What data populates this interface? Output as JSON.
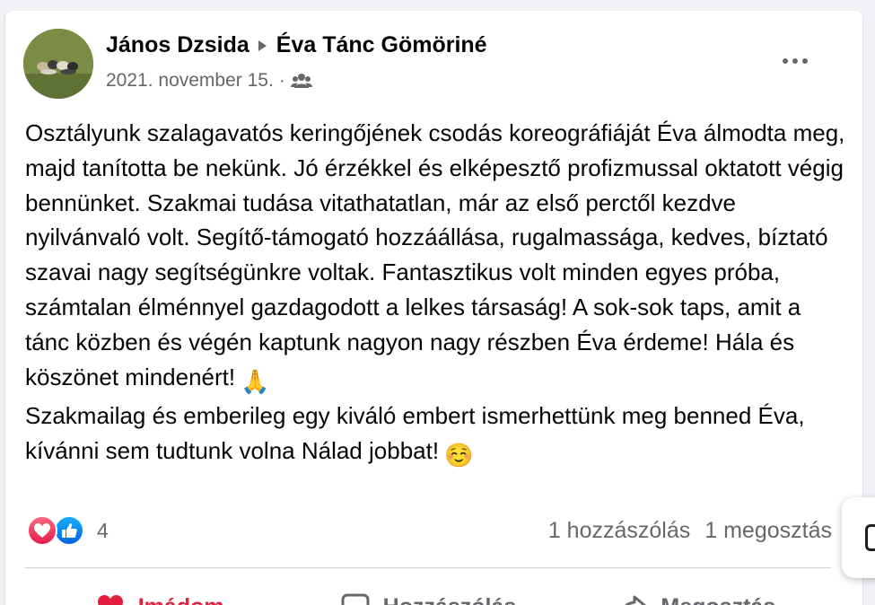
{
  "post": {
    "author": "János Dzsida",
    "target": "Éva Tánc Gömöriné",
    "date": "2021. november 15.",
    "separator": "·",
    "privacy_icon": "friends-icon",
    "paragraph1": "Osztályunk szalagavatós keringőjének csodás koreográfiáját Éva álmodta meg, majd tanította be nekünk. Jó érzékkel és elképesztő profizmussal oktatott végig bennünket. Szakmai tudása vitathatatlan, már az első perctől kezdve nyilvánvaló volt. Segítő-támogató hozzáállása, rugalmassága, kedves, bíztató szavai nagy segítségünkre voltak. Fantasztikus volt minden egyes próba, számtalan élménnyel gazdagodott a lelkes társaság! A sok-sok taps, amit a tánc közben és végén kaptunk nagyon nagy részben Éva érdeme! Hála és köszönet mindenért!",
    "paragraph1_emoji": "🙏",
    "paragraph2": "Szakmailag és emberileg egy kiváló embert ismerhettünk meg benned Éva, kívánni sem tudtunk volna Nálad jobbat!",
    "paragraph2_emoji": "☺️"
  },
  "reactions": {
    "count": "4",
    "types": [
      "love",
      "like"
    ]
  },
  "stats": {
    "comments": "1 hozzászólás",
    "shares": "1 megosztás"
  },
  "actions": {
    "love_label": "Imádom",
    "comment_label": "Hozzászólás",
    "share_label": "Megosztás"
  },
  "colors": {
    "love": "#e41e3f",
    "like": "#0866ff",
    "secondary_text": "#65676b"
  }
}
